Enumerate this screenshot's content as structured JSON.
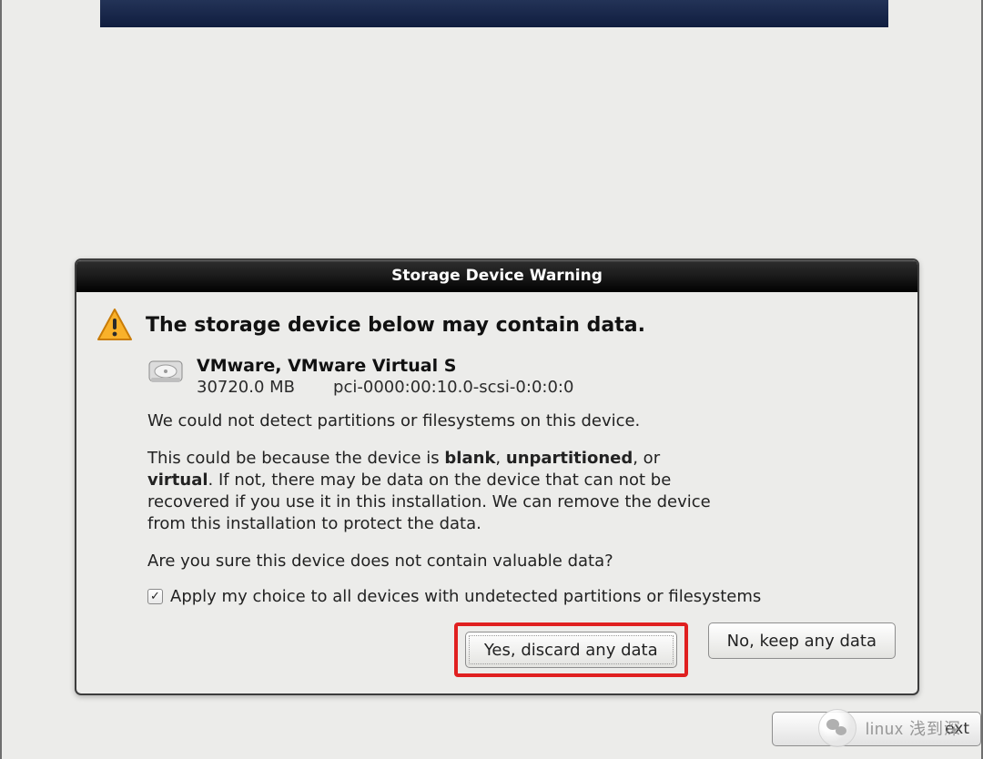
{
  "nav": {
    "next_label": "ext"
  },
  "dialog": {
    "title": "Storage Device Warning",
    "headline": "The storage device below may contain data.",
    "device": {
      "name": "VMware, VMware Virtual S",
      "size": "30720.0 MB",
      "path": "pci-0000:00:10.0-scsi-0:0:0:0"
    },
    "para1": "We could not detect partitions or filesystems on this device.",
    "para2_lead": "This could be because the device is ",
    "para2_b1": "blank",
    "para2_mid1": ", ",
    "para2_b2": "unpartitioned",
    "para2_mid2": ", or ",
    "para2_b3": "virtual",
    "para2_tail": ". If not, there may be data on the device that can not be recovered if you use it in this installation. We can remove the device from this installation to protect the data.",
    "para3": "Are you sure this device does not contain valuable data?",
    "checkbox_label": "Apply my choice to all devices with undetected partitions or filesystems",
    "checkbox_checked": true,
    "yes_label": "Yes, discard any data",
    "no_label": "No, keep any data"
  },
  "watermark": {
    "text": "linux 浅到深"
  },
  "icons": {
    "warning": "warning-triangle",
    "drive": "hard-drive"
  }
}
